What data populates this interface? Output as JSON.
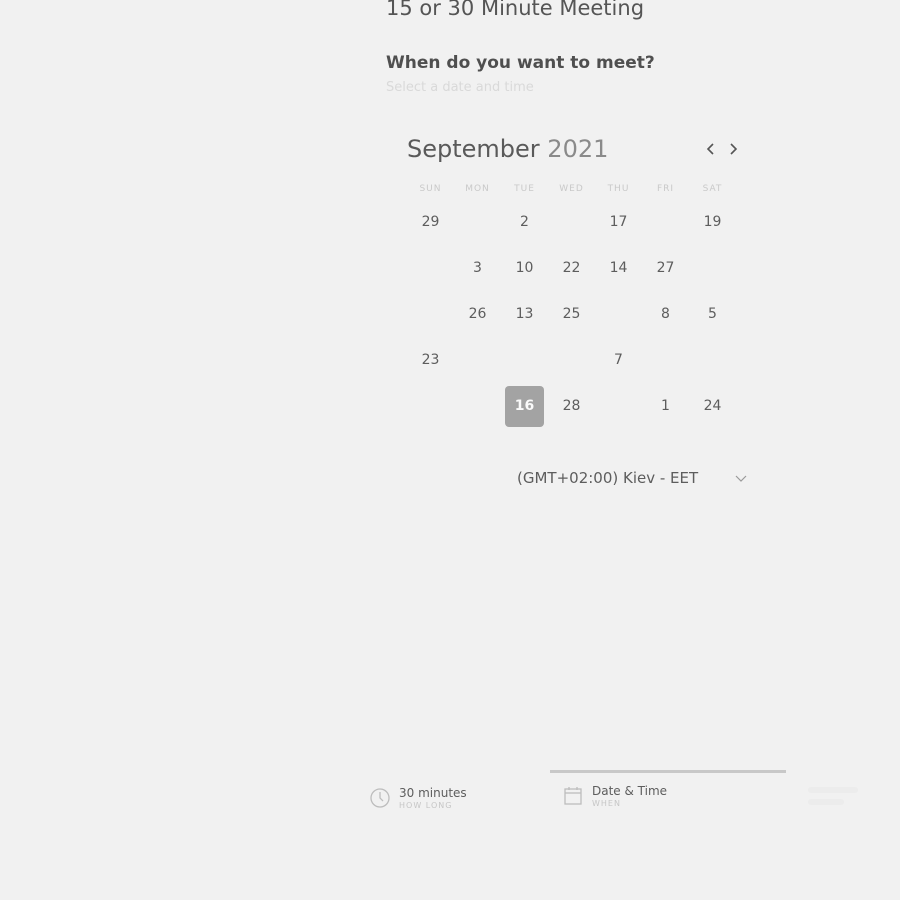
{
  "header": {
    "title": "15 or 30 Minute Meeting",
    "question": "When do you want to meet?",
    "subtitle": "Select a date and time"
  },
  "calendar": {
    "month": "September",
    "year": "2021",
    "prev_icon": "chevron-left-icon",
    "next_icon": "chevron-right-icon",
    "weekdays": [
      "SUN",
      "MON",
      "TUE",
      "WED",
      "THU",
      "FRI",
      "SAT"
    ],
    "weeks": [
      [
        "29",
        "",
        "2",
        "",
        "17",
        "",
        "19"
      ],
      [
        "",
        "3",
        "10",
        "22",
        "14",
        "27",
        ""
      ],
      [
        "",
        "26",
        "13",
        "25",
        "",
        "8",
        "5"
      ],
      [
        "23",
        "",
        "",
        "",
        "7",
        "",
        ""
      ],
      [
        "",
        "",
        "16",
        "28",
        "",
        "1",
        "24"
      ]
    ],
    "selected_day": "16"
  },
  "timezone": {
    "label": "(GMT+02:00) Kiev - EET",
    "icon": "chevron-down-icon"
  },
  "tabs": {
    "duration": {
      "label": "30 minutes",
      "sub": "HOW LONG",
      "icon": "clock-icon"
    },
    "datetime": {
      "label": "Date & Time",
      "sub": "WHEN",
      "icon": "calendar-icon"
    }
  },
  "colors": {
    "background": "#f1f1f1",
    "selected_day": "#a3a3a3",
    "text": "#5d5d5d"
  }
}
